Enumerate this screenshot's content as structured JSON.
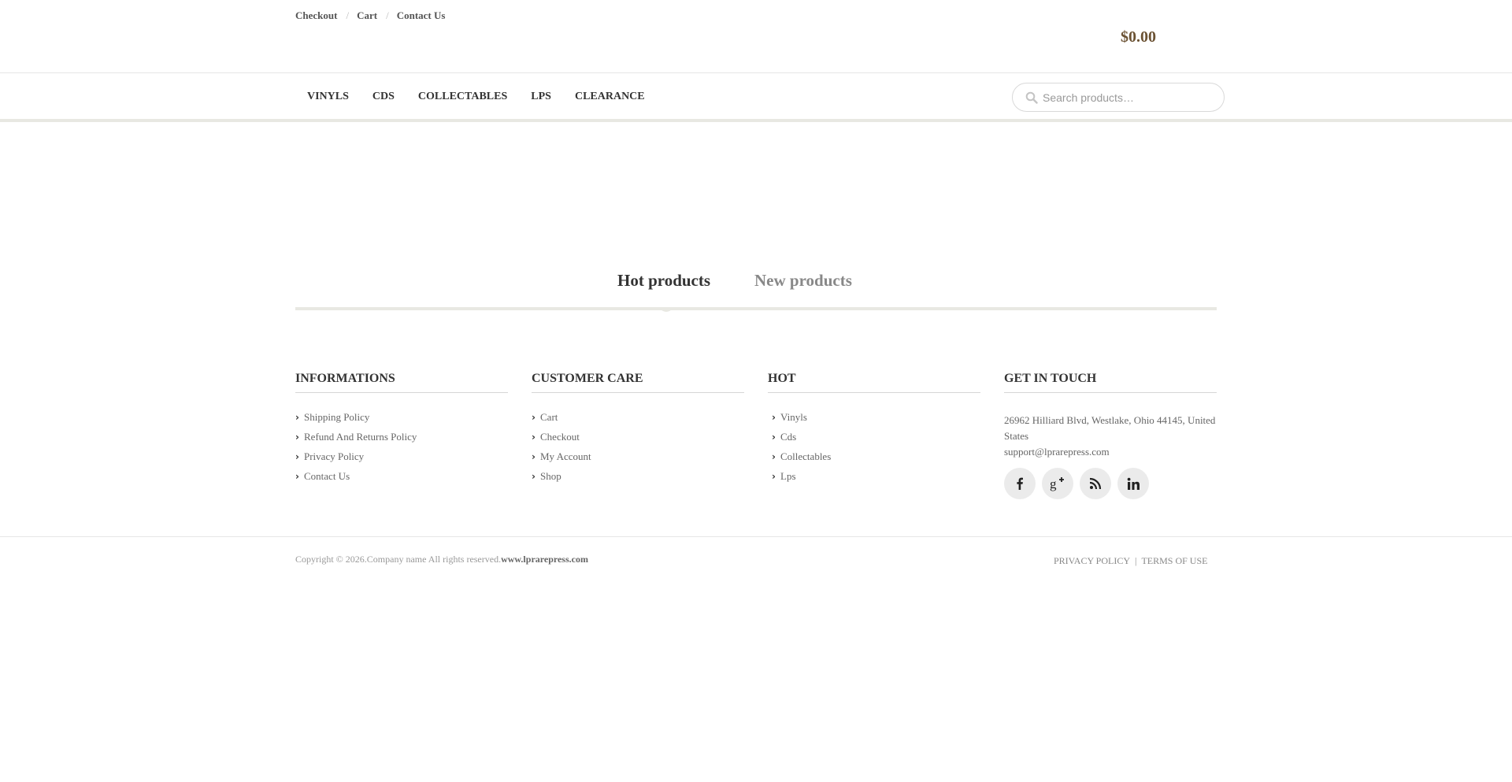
{
  "topbar": {
    "links": [
      {
        "label": "Checkout"
      },
      {
        "label": "Cart"
      },
      {
        "label": "Contact Us"
      }
    ],
    "separator": "/",
    "cart_total": "$0.00"
  },
  "nav": {
    "items": [
      {
        "label": "VINYLS"
      },
      {
        "label": "CDS"
      },
      {
        "label": "COLLECTABLES"
      },
      {
        "label": "LPS"
      },
      {
        "label": "CLEARANCE"
      }
    ],
    "search_placeholder": "Search products…",
    "search_value": ""
  },
  "tabs": {
    "active": "Hot products",
    "inactive": "New products"
  },
  "footer": {
    "informations": {
      "title": "INFORMATIONS",
      "items": [
        "Shipping Policy",
        "Refund And Returns Policy",
        "Privacy Policy",
        "Contact Us"
      ]
    },
    "customer_care": {
      "title": "CUSTOMER CARE",
      "items": [
        "Cart",
        "Checkout",
        "My Account",
        "Shop"
      ]
    },
    "hot": {
      "title": "HOT",
      "items": [
        "Vinyls",
        "Cds",
        "Collectables",
        "Lps"
      ]
    },
    "get_in_touch": {
      "title": "GET IN TOUCH",
      "address": "26962 Hilliard Blvd, Westlake, Ohio 44145, United States",
      "email": "support@lprarepress.com",
      "socials": [
        "facebook-icon",
        "google-plus-icon",
        "rss-icon",
        "linkedin-icon"
      ]
    }
  },
  "bottom": {
    "copyright": "Copyright © 2026.Company name All rights reserved.",
    "site": "www.lprarepress.com",
    "privacy": "PRIVACY POLICY",
    "pipe": "|",
    "terms": "TERMS OF USE"
  },
  "colors": {
    "cart_total": "#6b5233",
    "divider": "#e8e8e2",
    "social_bg": "#ebebeb"
  }
}
